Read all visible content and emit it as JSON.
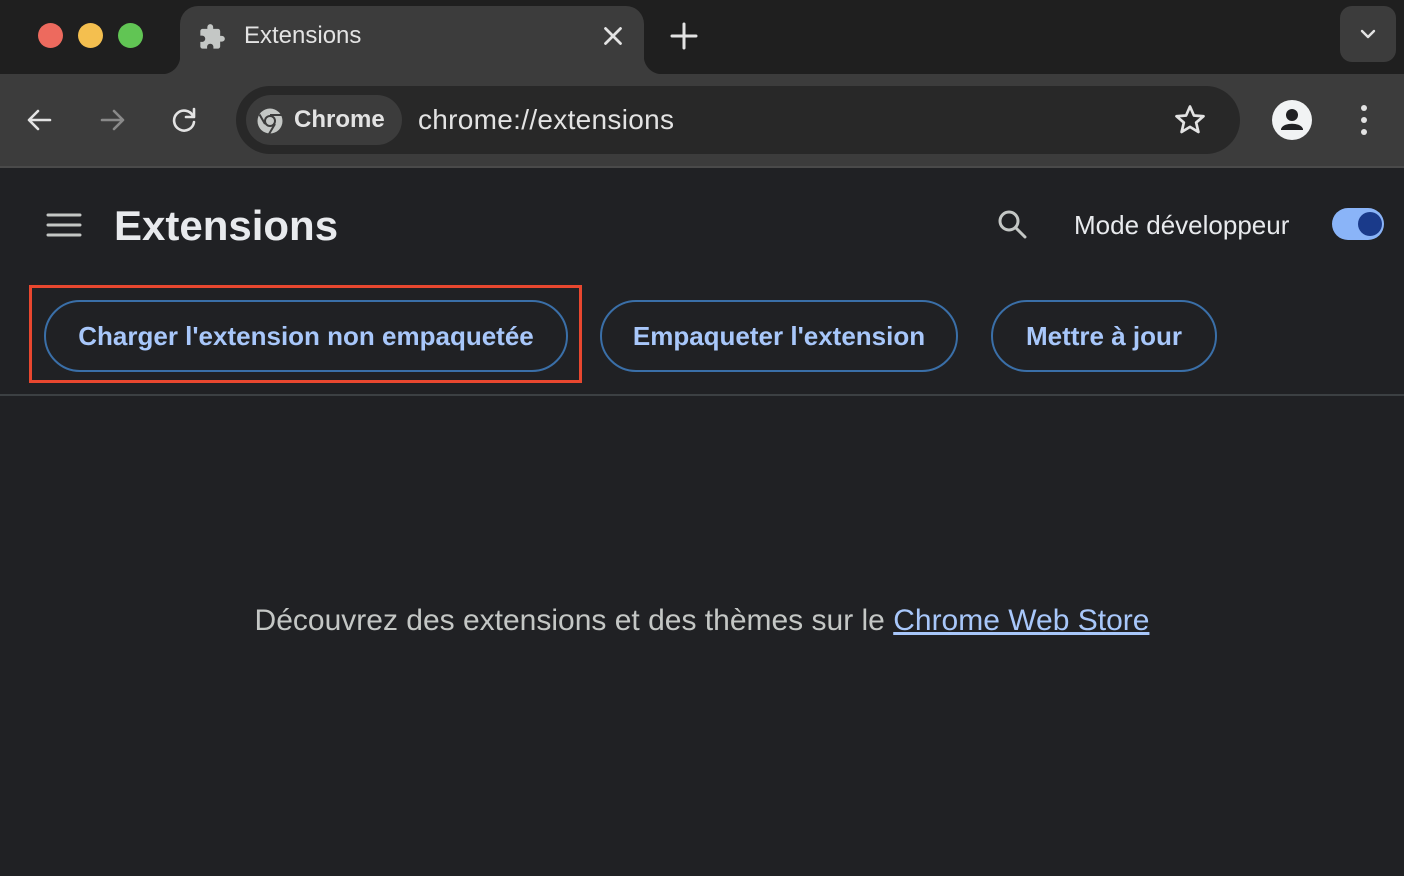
{
  "window": {
    "tab_title": "Extensions"
  },
  "toolbar": {
    "chip_label": "Chrome",
    "url": "chrome://extensions"
  },
  "page": {
    "title": "Extensions",
    "dev_mode_label": "Mode développeur",
    "dev_mode_enabled": true,
    "buttons": {
      "load_unpacked": "Charger l'extension non empaquetée",
      "pack": "Empaqueter l'extension",
      "update": "Mettre à jour"
    },
    "discover_text": "Découvrez des extensions et des thèmes sur le ",
    "discover_link": "Chrome Web Store"
  },
  "colors": {
    "accent": "#a8c7fa",
    "highlight_box": "#e8472f",
    "background": "#202124"
  }
}
